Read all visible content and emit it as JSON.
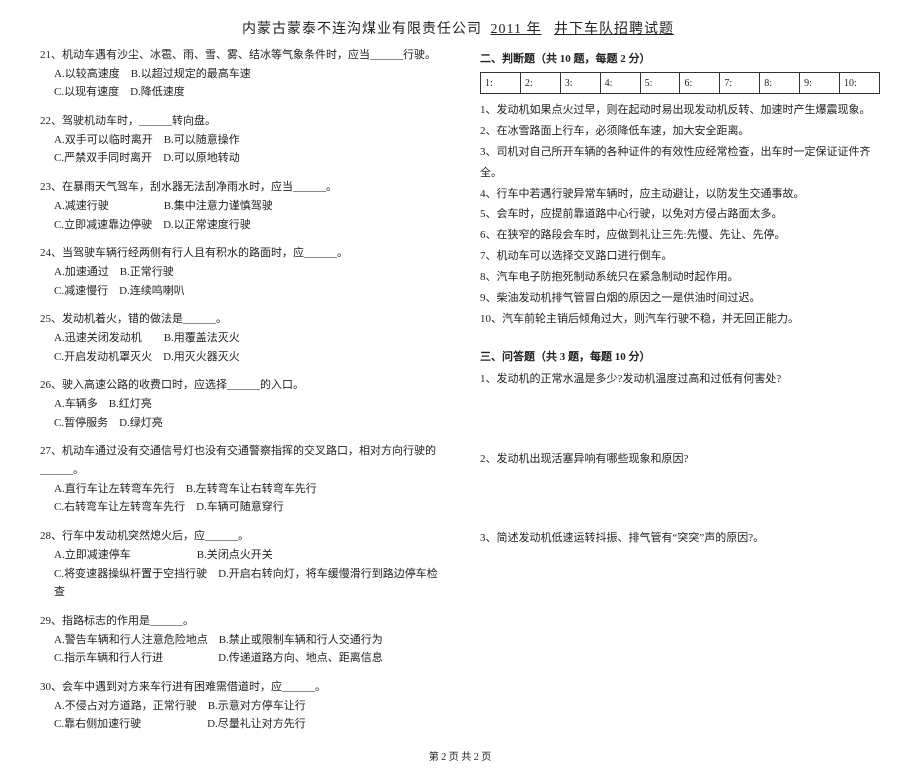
{
  "header": {
    "company": "内蒙古蒙泰不连沟煤业有限责任公司",
    "year": "2011 年",
    "exam": "井下车队招聘试题"
  },
  "left": {
    "q21": {
      "stem": "21、机动车遇有沙尘、冰雹、雨、雪、雾、结冰等气象条件时，应当______行驶。",
      "opts": "A.以较高速度　B.以超过规定的最高车速\nC.以现有速度　D.降低速度"
    },
    "q22": {
      "stem": "22、驾驶机动车时，______转向盘。",
      "opts": "A.双手可以临时离开　B.可以随意操作\nC.严禁双手同时离开　D.可以原地转动"
    },
    "q23": {
      "stem": "23、在暴雨天气驾车，刮水器无法刮净雨水时，应当______。",
      "opts": "A.减速行驶　　　　　B.集中注意力谨慎驾驶\nC.立即减速靠边停驶　D.以正常速度行驶"
    },
    "q24": {
      "stem": "24、当驾驶车辆行经两侧有行人且有积水的路面时，应______。",
      "opts": "A.加速通过　B.正常行驶\nC.减速慢行　D.连续鸣喇叭"
    },
    "q25": {
      "stem": "25、发动机着火，错的做法是______。",
      "opts": "A.迅速关闭发动机　　B.用覆盖法灭火\nC.开启发动机罩灭火　D.用灭火器灭火"
    },
    "q26": {
      "stem": "26、驶入高速公路的收费口时，应选择______的入口。",
      "opts": "A.车辆多　B.红灯亮\nC.暂停服务　D.绿灯亮"
    },
    "q27": {
      "stem": "27、机动车通过没有交通信号灯也没有交通警察指挥的交叉路口，相对方向行驶的______。",
      "opts": "A.直行车让左转弯车先行　B.左转弯车让右转弯车先行\nC.右转弯车让左转弯车先行　D.车辆可随意穿行"
    },
    "q28": {
      "stem": "28、行车中发动机突然熄火后，应______。",
      "opts": "A.立即减速停车　　　　　　B.关闭点火开关\nC.将变速器操纵杆置于空挡行驶　D.开启右转向灯，将车缓慢滑行到路边停车检查"
    },
    "q29": {
      "stem": "29、指路标志的作用是______。",
      "opts": "A.警告车辆和行人注意危险地点　B.禁止或限制车辆和行人交通行为\nC.指示车辆和行人行进　　　　　D.传递道路方向、地点、距离信息"
    },
    "q30": {
      "stem": "30、会车中遇到对方来车行进有困难需借道时，应______。",
      "opts": "A.不侵占对方道路，正常行驶　B.示意对方停车让行\nC.靠右侧加速行驶　　　　　　D.尽量礼让对方先行"
    }
  },
  "right": {
    "section2_head": "二、判断题（共 10 题，每题 2 分）",
    "tf_headers": [
      "1:",
      "2:",
      "3:",
      "4:",
      "5:",
      "6:",
      "7:",
      "8:",
      "9:",
      "10:"
    ],
    "tf": {
      "i1": "1、发动机如果点火过早，则在起动时易出现发动机反转、加速时产生爆震现象。",
      "i2": "2、在冰雪路面上行车，必须降低车速，加大安全距离。",
      "i3": "3、司机对自己所开车辆的各种证件的有效性应经常检查，出车时一定保证证件齐全。",
      "i4": "4、行车中若遇行驶异常车辆时，应主动避让，以防发生交通事故。",
      "i5": "5、会车时，应提前靠道路中心行驶，以免对方侵占路面太多。",
      "i6": "6、在狭窄的路段会车时，应做到礼让三先:先慢、先让、先停。",
      "i7": "7、机动车可以选择交叉路口进行倒车。",
      "i8": "8、汽车电子防抱死制动系统只在紧急制动时起作用。",
      "i9": "9、柴油发动机排气管冒白烟的原因之一是供油时间过迟。",
      "i10": "10、汽车前轮主销后倾角过大，则汽车行驶不稳，并无回正能力。"
    },
    "section3_head": "三、问答题（共 3 题，每题 10 分）",
    "essay": {
      "e1": "1、发动机的正常水温是多少?发动机温度过高和过低有何害处?",
      "e2": "2、发动机出现活塞异响有哪些现象和原因?",
      "e3": "3、简述发动机低速运转抖振、排气管有“突突”声的原因?。"
    }
  },
  "footer": "第 2 页  共 2 页"
}
